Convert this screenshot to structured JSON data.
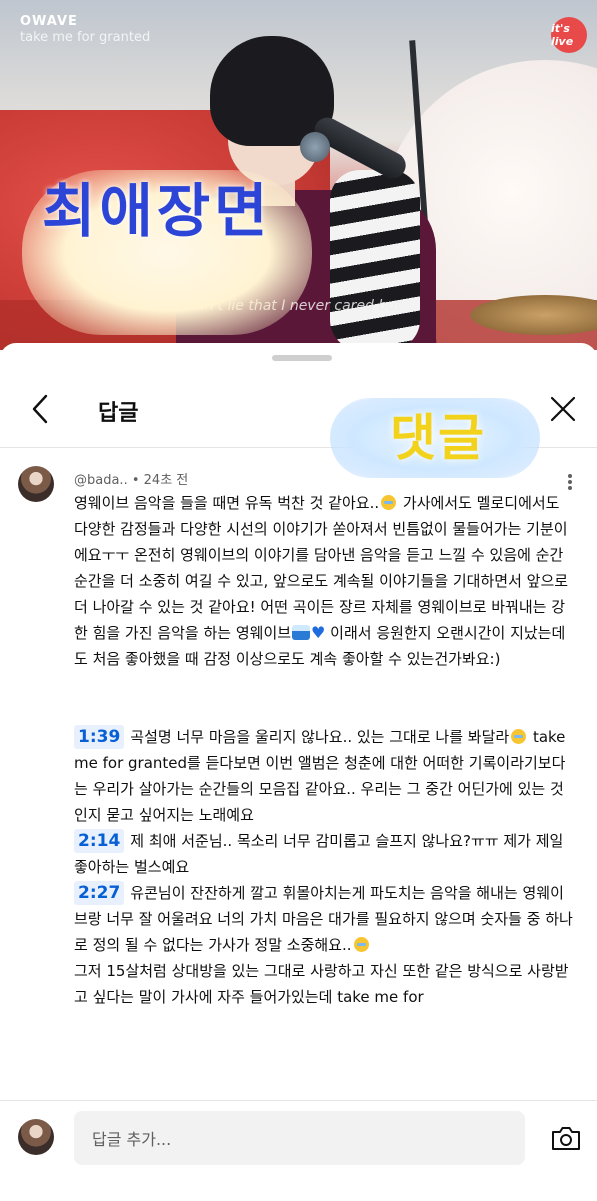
{
  "video": {
    "channel": "OWAVE",
    "song": "take me for granted",
    "logo": "it's live",
    "caption": "I can't lie that I never cared but",
    "sticker_text": "최애장면"
  },
  "sheet": {
    "title": "답글",
    "sticker_text": "댓글",
    "icons": {
      "back": "chevron-left-icon",
      "close": "close-icon"
    }
  },
  "comment": {
    "author": "@bada..",
    "separator": "•",
    "time": "24초 전",
    "paragraph1": [
      "영웨이브 음악을 들을 때면 유독 벅찬 것 같아요..",
      "가사에서도 멜로디에서도 다양한 감정들과 다양한 시선의 이야기가 쏟아져서 빈틈없이 물들어가는 기분이에요ㅜㅜ 온전히 영웨이브의 이야기를 담아낸 음악을 듣고 느낄 수 있음에 순간순간을 더 소중히 여길 수 있고, 앞으로도 계속될 이야기들을 기대하면서 앞으로 더 나아갈 수 있는 것 같아요! 어떤 곡이든 장르 자체를 영웨이브로 바꿔내는 강한 힘을 가진 음악을 하는 영웨이브",
      "이래서 응원한지 오랜시간이 지났는데도 처음 좋아했을 때 감정 이상으로도 계속 좋아할 수 있는건가봐요:)"
    ],
    "segments": [
      {
        "time": "1:39",
        "text_a": "곡설명 너무 마음을 울리지 않나요.. 있는 그대로 나를 봐달라",
        "text_b": " take me for granted를 듣다보면 이번 앨범은 청춘에 대한 어떠한 기록이라기보다는 우리가 살아가는 순간들의 모음집 같아요.. 우리는 그 중간 어딘가에 있는 것인지 묻고 싶어지는 노래예요"
      },
      {
        "time": "2:14",
        "text_a": "제 최애 서준님.. 목소리 너무 감미롭고 슬프지 않나요?ㅠㅠ 제가 제일 좋아하는 벌스예요",
        "text_b": ""
      },
      {
        "time": "2:27",
        "text_a": "유콘님이 잔잔하게 깔고 휘몰아치는게 파도치는 음악을 해내는 영웨이브랑 너무 잘 어울려요 너의 가치 마음은 대가를 필요하지 않으며 숫자들 중 하나로 정의 될 수 없다는 가사가 정말 소중해요..",
        "text_b": ""
      }
    ],
    "tail": "그저 15살처럼 상대방을 있는 그대로 사랑하고 자신 또한 같은 방식으로 사랑받고 싶다는 말이 가사에 자주 들어가있는데 take me for"
  },
  "reply_bar": {
    "placeholder": "답글 추가...",
    "camera_icon": "camera-icon"
  }
}
